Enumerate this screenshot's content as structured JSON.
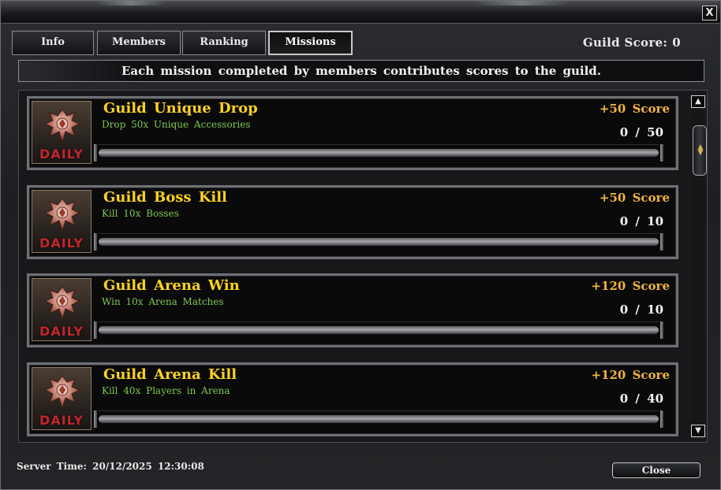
{
  "window": {
    "close_glyph": "X"
  },
  "tabs": [
    {
      "label": "Info",
      "active": false
    },
    {
      "label": "Members",
      "active": false
    },
    {
      "label": "Ranking",
      "active": false
    },
    {
      "label": "Missions",
      "active": true
    }
  ],
  "guild_score": {
    "label": "Guild Score:",
    "value": "0"
  },
  "banner": "Each mission completed by members contributes scores to the guild.",
  "missions": [
    {
      "badge": "DAILY",
      "title": "Guild Unique Drop",
      "description": "Drop 50x Unique Accessories",
      "reward": "+50 Score",
      "progress_text": "0 / 50",
      "progress": 0
    },
    {
      "badge": "DAILY",
      "title": "Guild Boss Kill",
      "description": "Kill 10x Bosses",
      "reward": "+50 Score",
      "progress_text": "0 / 10",
      "progress": 0
    },
    {
      "badge": "DAILY",
      "title": "Guild Arena Win",
      "description": "Win 10x Arena Matches",
      "reward": "+120 Score",
      "progress_text": "0 / 10",
      "progress": 0
    },
    {
      "badge": "DAILY",
      "title": "Guild Arena Kill",
      "description": "Kill 40x Players in Arena",
      "reward": "+120 Score",
      "progress_text": "0 / 40",
      "progress": 0
    }
  ],
  "scrollbar": {
    "up_glyph": "▲",
    "down_glyph": "▼"
  },
  "footer": {
    "server_time": "Server Time: 20/12/2025 12:30:08",
    "close_label": "Close"
  },
  "colors": {
    "title": "#ffd21f",
    "description": "#7ec850",
    "reward": "#f0b43c",
    "daily": "#c1272d"
  },
  "icons": {
    "mission_icon": "phoenix-emblem-icon"
  }
}
